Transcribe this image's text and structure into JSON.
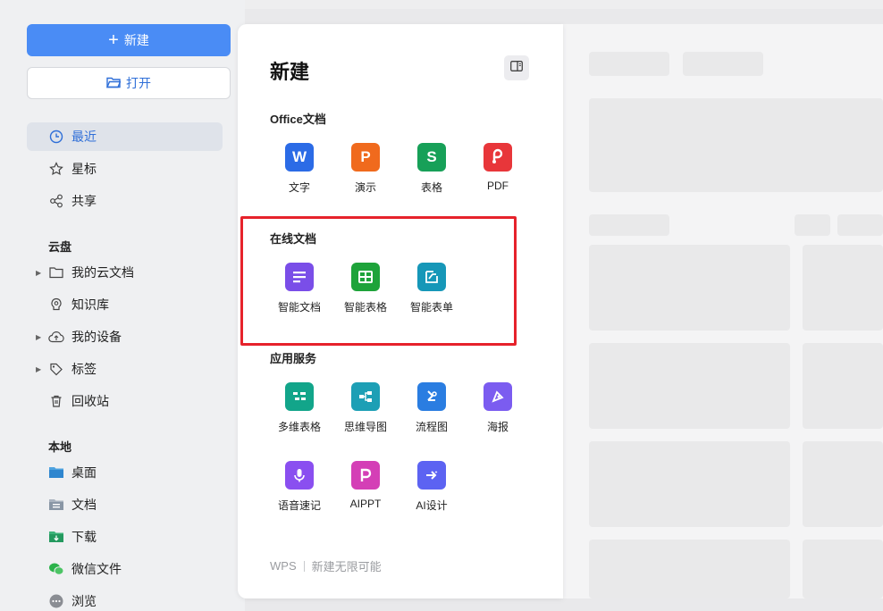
{
  "sidebar": {
    "new_label": "新建",
    "open_label": "打开",
    "nav": [
      {
        "label": "最近",
        "icon": "clock-icon"
      },
      {
        "label": "星标",
        "icon": "star-icon"
      },
      {
        "label": "共享",
        "icon": "share-icon"
      }
    ],
    "cloud_title": "云盘",
    "cloud": [
      {
        "label": "我的云文档",
        "icon": "folder-icon"
      },
      {
        "label": "知识库",
        "icon": "knowledge-icon"
      },
      {
        "label": "我的设备",
        "icon": "cloud-device-icon"
      },
      {
        "label": "标签",
        "icon": "tag-icon"
      },
      {
        "label": "回收站",
        "icon": "trash-icon"
      }
    ],
    "local_title": "本地",
    "local": [
      {
        "label": "桌面",
        "icon": "desktop-folder-icon"
      },
      {
        "label": "文档",
        "icon": "documents-folder-icon"
      },
      {
        "label": "下载",
        "icon": "download-folder-icon"
      },
      {
        "label": "微信文件",
        "icon": "wechat-icon"
      },
      {
        "label": "浏览",
        "icon": "browse-icon"
      }
    ]
  },
  "panel": {
    "title": "新建",
    "office_title": "Office文档",
    "office": [
      {
        "label": "文字",
        "glyph": "W",
        "color": "#2b6be6"
      },
      {
        "label": "演示",
        "glyph": "P",
        "color": "#f06a1d"
      },
      {
        "label": "表格",
        "glyph": "S",
        "color": "#17a058"
      },
      {
        "label": "PDF",
        "glyph": "",
        "color": "#e8363a"
      }
    ],
    "online_title": "在线文档",
    "online": [
      {
        "label": "智能文档",
        "color": "#7a4ee8"
      },
      {
        "label": "智能表格",
        "color": "#1ea33a"
      },
      {
        "label": "智能表单",
        "color": "#1697b8"
      }
    ],
    "service_title": "应用服务",
    "services": [
      {
        "label": "多维表格",
        "color": "#12a58a"
      },
      {
        "label": "思维导图",
        "color": "#1d9fb5"
      },
      {
        "label": "流程图",
        "color": "#2a7de1"
      },
      {
        "label": "海报",
        "color": "#7b5cf0"
      },
      {
        "label": "语音速记",
        "color": "#8a4ff0"
      },
      {
        "label": "AIPPT",
        "color": "#d43fb6"
      },
      {
        "label": "AI设计",
        "color": "#5c63f2"
      }
    ],
    "footer_brand": "WPS",
    "footer_slogan": "新建无限可能"
  }
}
